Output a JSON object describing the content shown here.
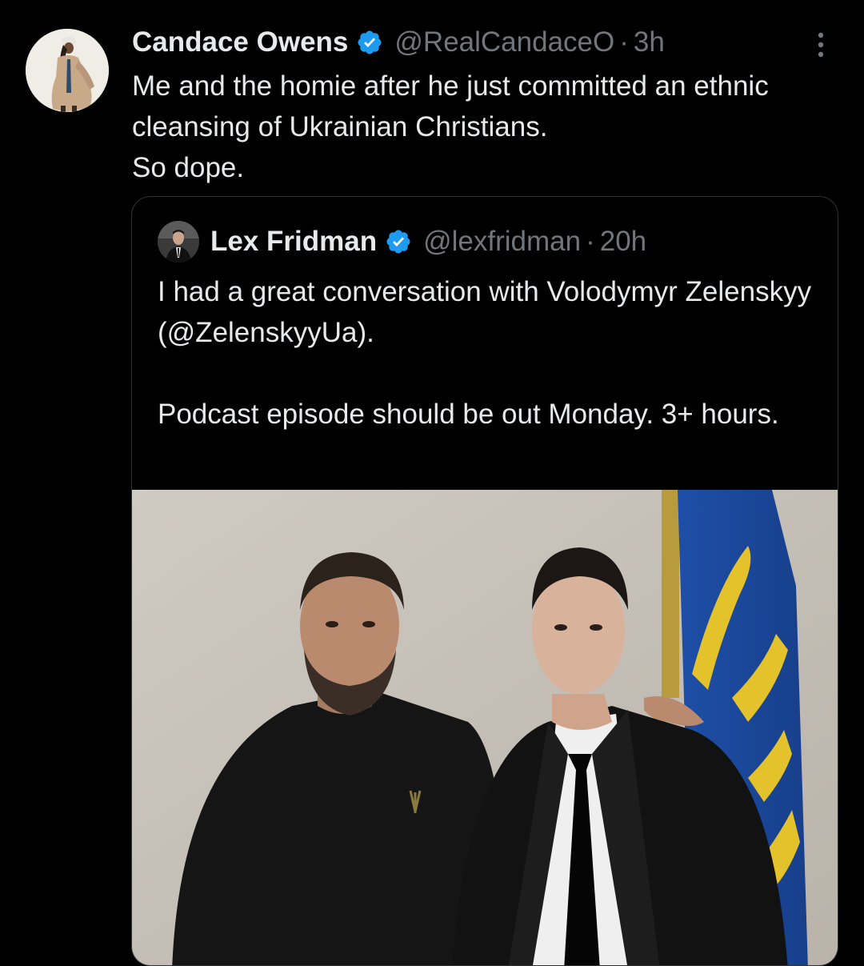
{
  "tweet": {
    "author_name": "Candace Owens",
    "handle": "@RealCandaceO",
    "separator": "·",
    "time": "3h",
    "text_lines": [
      "Me and the homie after he just committed an ethnic cleansing of Ukrainian Christians.",
      "So dope."
    ]
  },
  "quote": {
    "author_name": "Lex Fridman",
    "handle": "@lexfridman",
    "separator": "·",
    "time": "20h",
    "paragraphs": [
      "I had a great conversation with Volodymyr Zelenskyy (@ZelenskyyUa).",
      "Podcast episode should be out Monday. 3+ hours."
    ]
  },
  "icons": {
    "verified": "verified-badge-icon",
    "more": "more-options-icon"
  },
  "colors": {
    "background": "#000000",
    "text_primary": "#e7e9ea",
    "text_secondary": "#71767b",
    "verified_blue": "#1d9bf0",
    "border": "#2f3336"
  }
}
